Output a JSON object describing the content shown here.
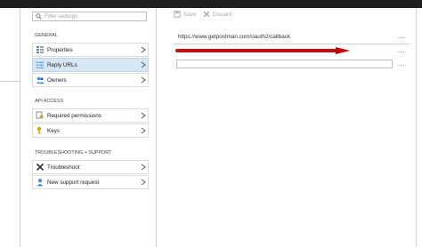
{
  "search": {
    "placeholder": "Filter settings"
  },
  "sections": [
    {
      "title": "GENERAL",
      "items": [
        {
          "label": "Properties",
          "icon": "properties-icon",
          "selected": false
        },
        {
          "label": "Reply URLs",
          "icon": "list-icon",
          "selected": true
        },
        {
          "label": "Owners",
          "icon": "people-icon",
          "selected": false
        }
      ]
    },
    {
      "title": "API ACCESS",
      "items": [
        {
          "label": "Required permissions",
          "icon": "key-permissions-icon",
          "selected": false
        },
        {
          "label": "Keys",
          "icon": "key-icon",
          "selected": false
        }
      ]
    },
    {
      "title": "TROUBLESHOOTING + SUPPORT",
      "items": [
        {
          "label": "Troubleshoot",
          "icon": "wrench-icon",
          "selected": false
        },
        {
          "label": "New support request",
          "icon": "support-icon",
          "selected": false
        }
      ]
    }
  ],
  "toolbar": {
    "save_label": "Save",
    "discard_label": "Discard"
  },
  "reply_urls": {
    "values": [
      "https://www.getpostman.com/oauth2/callback",
      "",
      ""
    ],
    "more_label": "...",
    "annotation_color": "#c40000"
  },
  "colors": {
    "selected_row": "#d6e6f5",
    "topbar": "#1e1e1e"
  }
}
